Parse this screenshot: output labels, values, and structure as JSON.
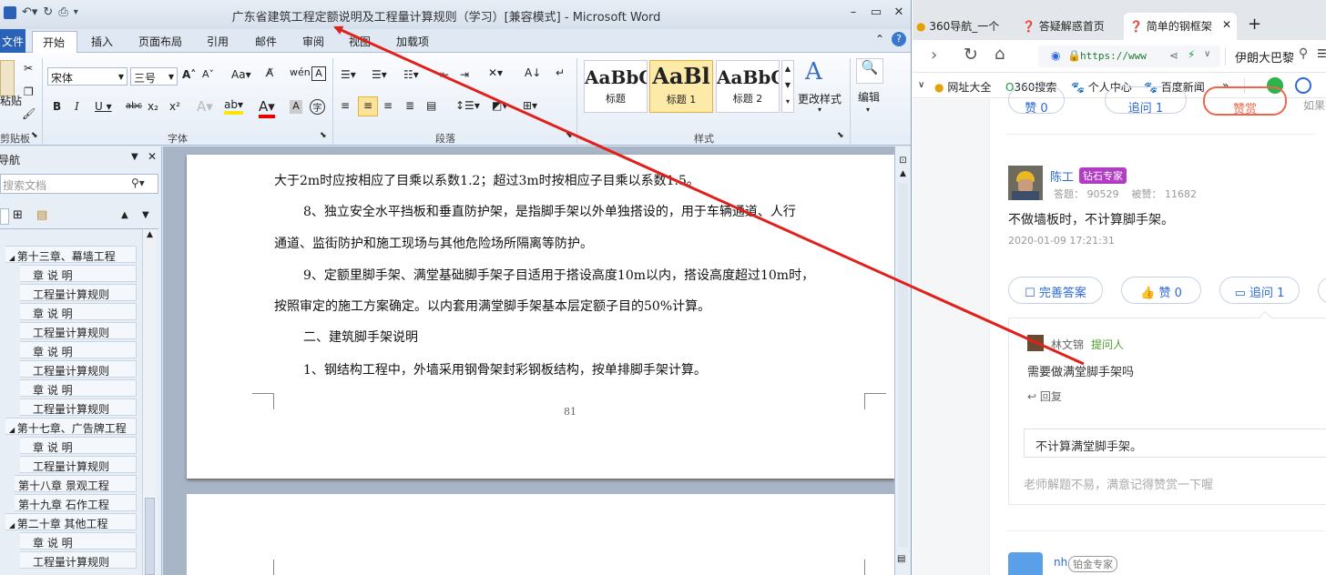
{
  "word": {
    "title": "广东省建筑工程定额说明及工程量计算规则（学习）[兼容模式] - Microsoft Word",
    "tabs": [
      "文件",
      "开始",
      "插入",
      "页面布局",
      "引用",
      "邮件",
      "审阅",
      "视图",
      "加载项"
    ],
    "ribbon": {
      "font_name": "宋体",
      "font_size": "三号",
      "clipboard_label": "剪贴板",
      "paste_label": "粘贴",
      "font_label": "字体",
      "paragraph_label": "段落",
      "styles_label": "样式",
      "styles": [
        {
          "preview": "AaBbC",
          "name": "标题"
        },
        {
          "preview": "AaBl",
          "name": "标题 1"
        },
        {
          "preview": "AaBbC",
          "name": "标题 2"
        }
      ],
      "change_styles": "更改样式",
      "edit": "编辑"
    },
    "nav": {
      "header": "导航",
      "search_placeholder": "搜索文档",
      "items": [
        {
          "text": "第十三章、幕墙工程",
          "level": 1,
          "expanded": true
        },
        {
          "text": "章 说 明",
          "level": 2
        },
        {
          "text": "工程量计算规则",
          "level": 2
        },
        {
          "text": "章  说  明",
          "level": 2
        },
        {
          "text": "工程量计算规则",
          "level": 2
        },
        {
          "text": "章 说 明",
          "level": 2
        },
        {
          "text": "工程量计算规则",
          "level": 2
        },
        {
          "text": "章 说 明",
          "level": 2
        },
        {
          "text": "工程量计算规则",
          "level": 2
        },
        {
          "text": "第十七章、广告牌工程",
          "level": 1,
          "expanded": true
        },
        {
          "text": "章  说  明",
          "level": 2
        },
        {
          "text": "工程量计算规则",
          "level": 2
        },
        {
          "text": "第十八章 景观工程",
          "level": 1
        },
        {
          "text": "第十九章 石作工程",
          "level": 1
        },
        {
          "text": "第二十章 其他工程",
          "level": 1,
          "expanded": true
        },
        {
          "text": "章  说  明",
          "level": 2
        },
        {
          "text": "工程量计算规则",
          "level": 2
        }
      ]
    },
    "document": {
      "lines": [
        "大于2m时应按相应了目乘以系数1.2；超过3m时按相应子目乘以系数1.5。",
        "8、独立安全水平挡板和垂直防护架，是指脚手架以外单独搭设的，用于车辆通道、人行",
        "通道、监街防护和施工现场与其他危险场所隔离等防护。",
        "9、定额里脚手架、满堂基础脚手架子目适用于搭设高度10m以内，搭设高度超过10m时，",
        "按照审定的施工方案确定。以内套用满堂脚手架基本层定额子目的50%计算。",
        "二、建筑脚手架说明",
        "1、钢结构工程中，外墙采用钢骨架封彩钢板结构，按单排脚手架计算。"
      ],
      "page_number": "81"
    }
  },
  "browser": {
    "tabs": [
      "360导航_一个",
      "答疑解惑首页",
      "简单的钢框架"
    ],
    "url": "https://www",
    "user": "伊朗大巴黎",
    "favorites": [
      "网址大全",
      "360搜索",
      "个人中心",
      "百度新闻"
    ],
    "top_buttons": [
      "赞 0",
      "追问 1",
      "赞赏",
      "如果有"
    ],
    "answer": {
      "name": "陈工",
      "badge": "钻石专家",
      "stats": "答题： 90529    被赞： 11682",
      "text": "不做墙板时，不计算脚手架。",
      "time": "2020-01-09 17:21:31",
      "actions": [
        "完善答案",
        "赞 0",
        "追问 1"
      ]
    },
    "followup": {
      "name": "林文锦",
      "role": "提问人",
      "question": "需要做满堂脚手架吗",
      "reply": "回复",
      "answer": "不计算满堂脚手架。",
      "tip": "老师解题不易，满意记得赞赏一下喔"
    },
    "next_answer": {
      "name": "nh",
      "badge": "铂金专家"
    }
  },
  "colors": {
    "arrow": "#e0201b",
    "word_blue": "#2a62b7",
    "link_blue": "#2d69d9",
    "badge_purple": "#b23cc4"
  }
}
